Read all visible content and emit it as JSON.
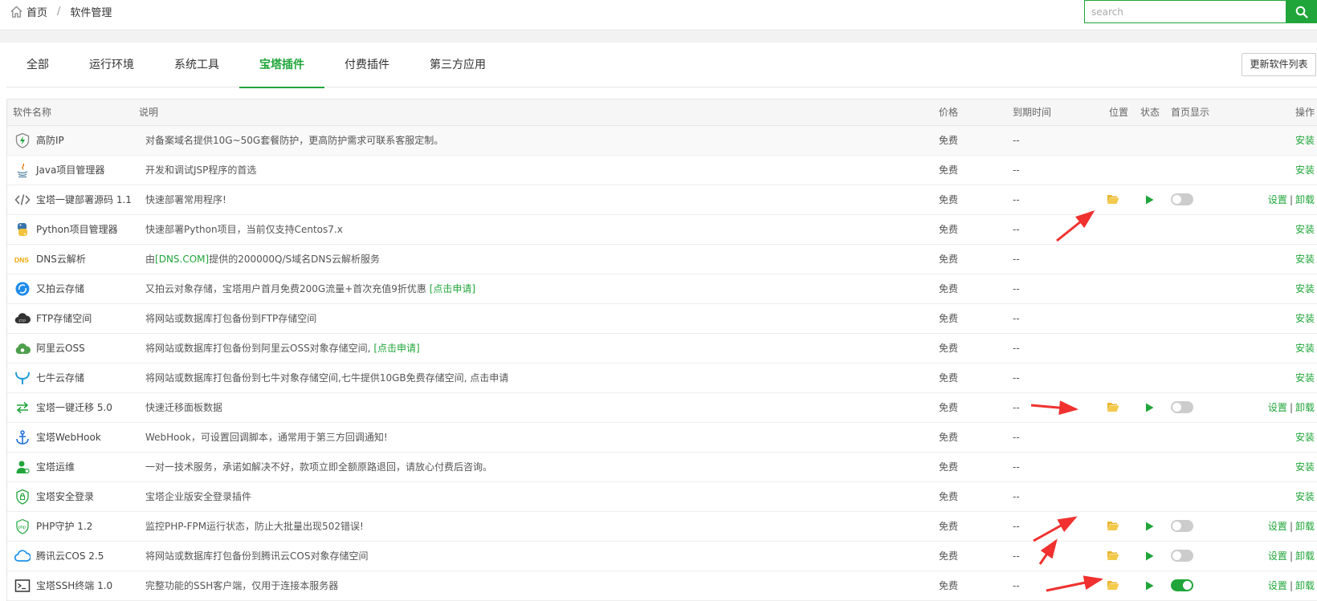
{
  "breadcrumb": {
    "home": "首页",
    "separator": "/",
    "current": "软件管理"
  },
  "search": {
    "placeholder": "search"
  },
  "tabs": [
    "全部",
    "运行环境",
    "系统工具",
    "宝塔插件",
    "付费插件",
    "第三方应用"
  ],
  "active_tab": "宝塔插件",
  "update_button": "更新软件列表",
  "columns": {
    "name": "软件名称",
    "desc": "说明",
    "price": "价格",
    "expire": "到期时间",
    "location": "位置",
    "status": "状态",
    "home": "首页显示",
    "ops": "操作"
  },
  "ops_labels": {
    "install": "安装",
    "settings": "设置",
    "uninstall": "卸载",
    "pipe": "|"
  },
  "rows": [
    {
      "name": "高防IP",
      "icon": "shield-lightning-icon",
      "desc": "对备案域名提供10G~50G套餐防护，更高防护需求可联系客服定制。",
      "price": "免费",
      "expire": "--",
      "installed": false
    },
    {
      "name": "Java项目管理器",
      "icon": "java-icon",
      "desc": "开发和调试JSP程序的首选",
      "price": "免费",
      "expire": "--",
      "installed": false
    },
    {
      "name": "宝塔一键部署源码 1.1",
      "icon": "code-icon",
      "desc": "快速部署常用程序!",
      "price": "免费",
      "expire": "--",
      "installed": true,
      "home": false
    },
    {
      "name": "Python项目管理器",
      "icon": "python-icon",
      "desc": "快速部署Python项目，当前仅支持Centos7.x",
      "price": "免费",
      "expire": "--",
      "installed": false
    },
    {
      "name": "DNS云解析",
      "icon": "dns-icon",
      "desc_pre": "由",
      "desc_link": "[DNS.COM]",
      "desc_post": "提供的200000Q/S域名DNS云解析服务",
      "price": "免费",
      "expire": "--",
      "installed": false
    },
    {
      "name": "又拍云存储",
      "icon": "upyun-icon",
      "desc_pre": "又拍云对象存储，宝塔用户首月免费200G流量+首次充值9折优惠 ",
      "desc_link": "[点击申请]",
      "desc_post": "",
      "price": "免费",
      "expire": "--",
      "installed": false
    },
    {
      "name": "FTP存储空间",
      "icon": "ftp-cloud-icon",
      "desc": "将网站或数据库打包备份到FTP存储空间",
      "price": "免费",
      "expire": "--",
      "installed": false
    },
    {
      "name": "阿里云OSS",
      "icon": "aliyun-oss-icon",
      "desc_pre": "将网站或数据库打包备份到阿里云OSS对象存储空间, ",
      "desc_link": "[点击申请]",
      "desc_post": "",
      "price": "免费",
      "expire": "--",
      "installed": false
    },
    {
      "name": "七牛云存储",
      "icon": "qiniu-icon",
      "desc": "将网站或数据库打包备份到七牛对象存储空间,七牛提供10GB免费存储空间, 点击申请",
      "price": "免费",
      "expire": "--",
      "installed": false
    },
    {
      "name": "宝塔一键迁移 5.0",
      "icon": "migrate-arrows-icon",
      "desc": "快速迁移面板数据",
      "price": "免费",
      "expire": "--",
      "installed": true,
      "home": false
    },
    {
      "name": "宝塔WebHook",
      "icon": "anchor-icon",
      "desc": "WebHook，可设置回调脚本，通常用于第三方回调通知!",
      "price": "免费",
      "expire": "--",
      "installed": false
    },
    {
      "name": "宝塔运维",
      "icon": "ops-user-icon",
      "desc": "一对一技术服务，承诺如解决不好，款项立即全额原路退回，请放心付费后咨询。",
      "price": "免费",
      "expire": "--",
      "installed": false
    },
    {
      "name": "宝塔安全登录",
      "icon": "secure-login-icon",
      "desc": "宝塔企业版安全登录插件",
      "price": "免费",
      "expire": "--",
      "installed": false
    },
    {
      "name": "PHP守护 1.2",
      "icon": "php-guard-icon",
      "desc": "监控PHP-FPM运行状态，防止大批量出现502错误!",
      "price": "免费",
      "expire": "--",
      "installed": true,
      "home": false
    },
    {
      "name": "腾讯云COS 2.5",
      "icon": "tencent-cos-icon",
      "desc": "将网站或数据库打包备份到腾讯云COS对象存储空间",
      "price": "免费",
      "expire": "--",
      "installed": true,
      "home": false
    },
    {
      "name": "宝塔SSH终端 1.0",
      "icon": "terminal-icon",
      "desc": "完整功能的SSH客户端，仅用于连接本服务器",
      "price": "免费",
      "expire": "--",
      "installed": true,
      "home": true
    }
  ],
  "colors": {
    "accent": "#20a53a",
    "folder": "#e8b730",
    "annotation_arrow": "#f0312f"
  }
}
